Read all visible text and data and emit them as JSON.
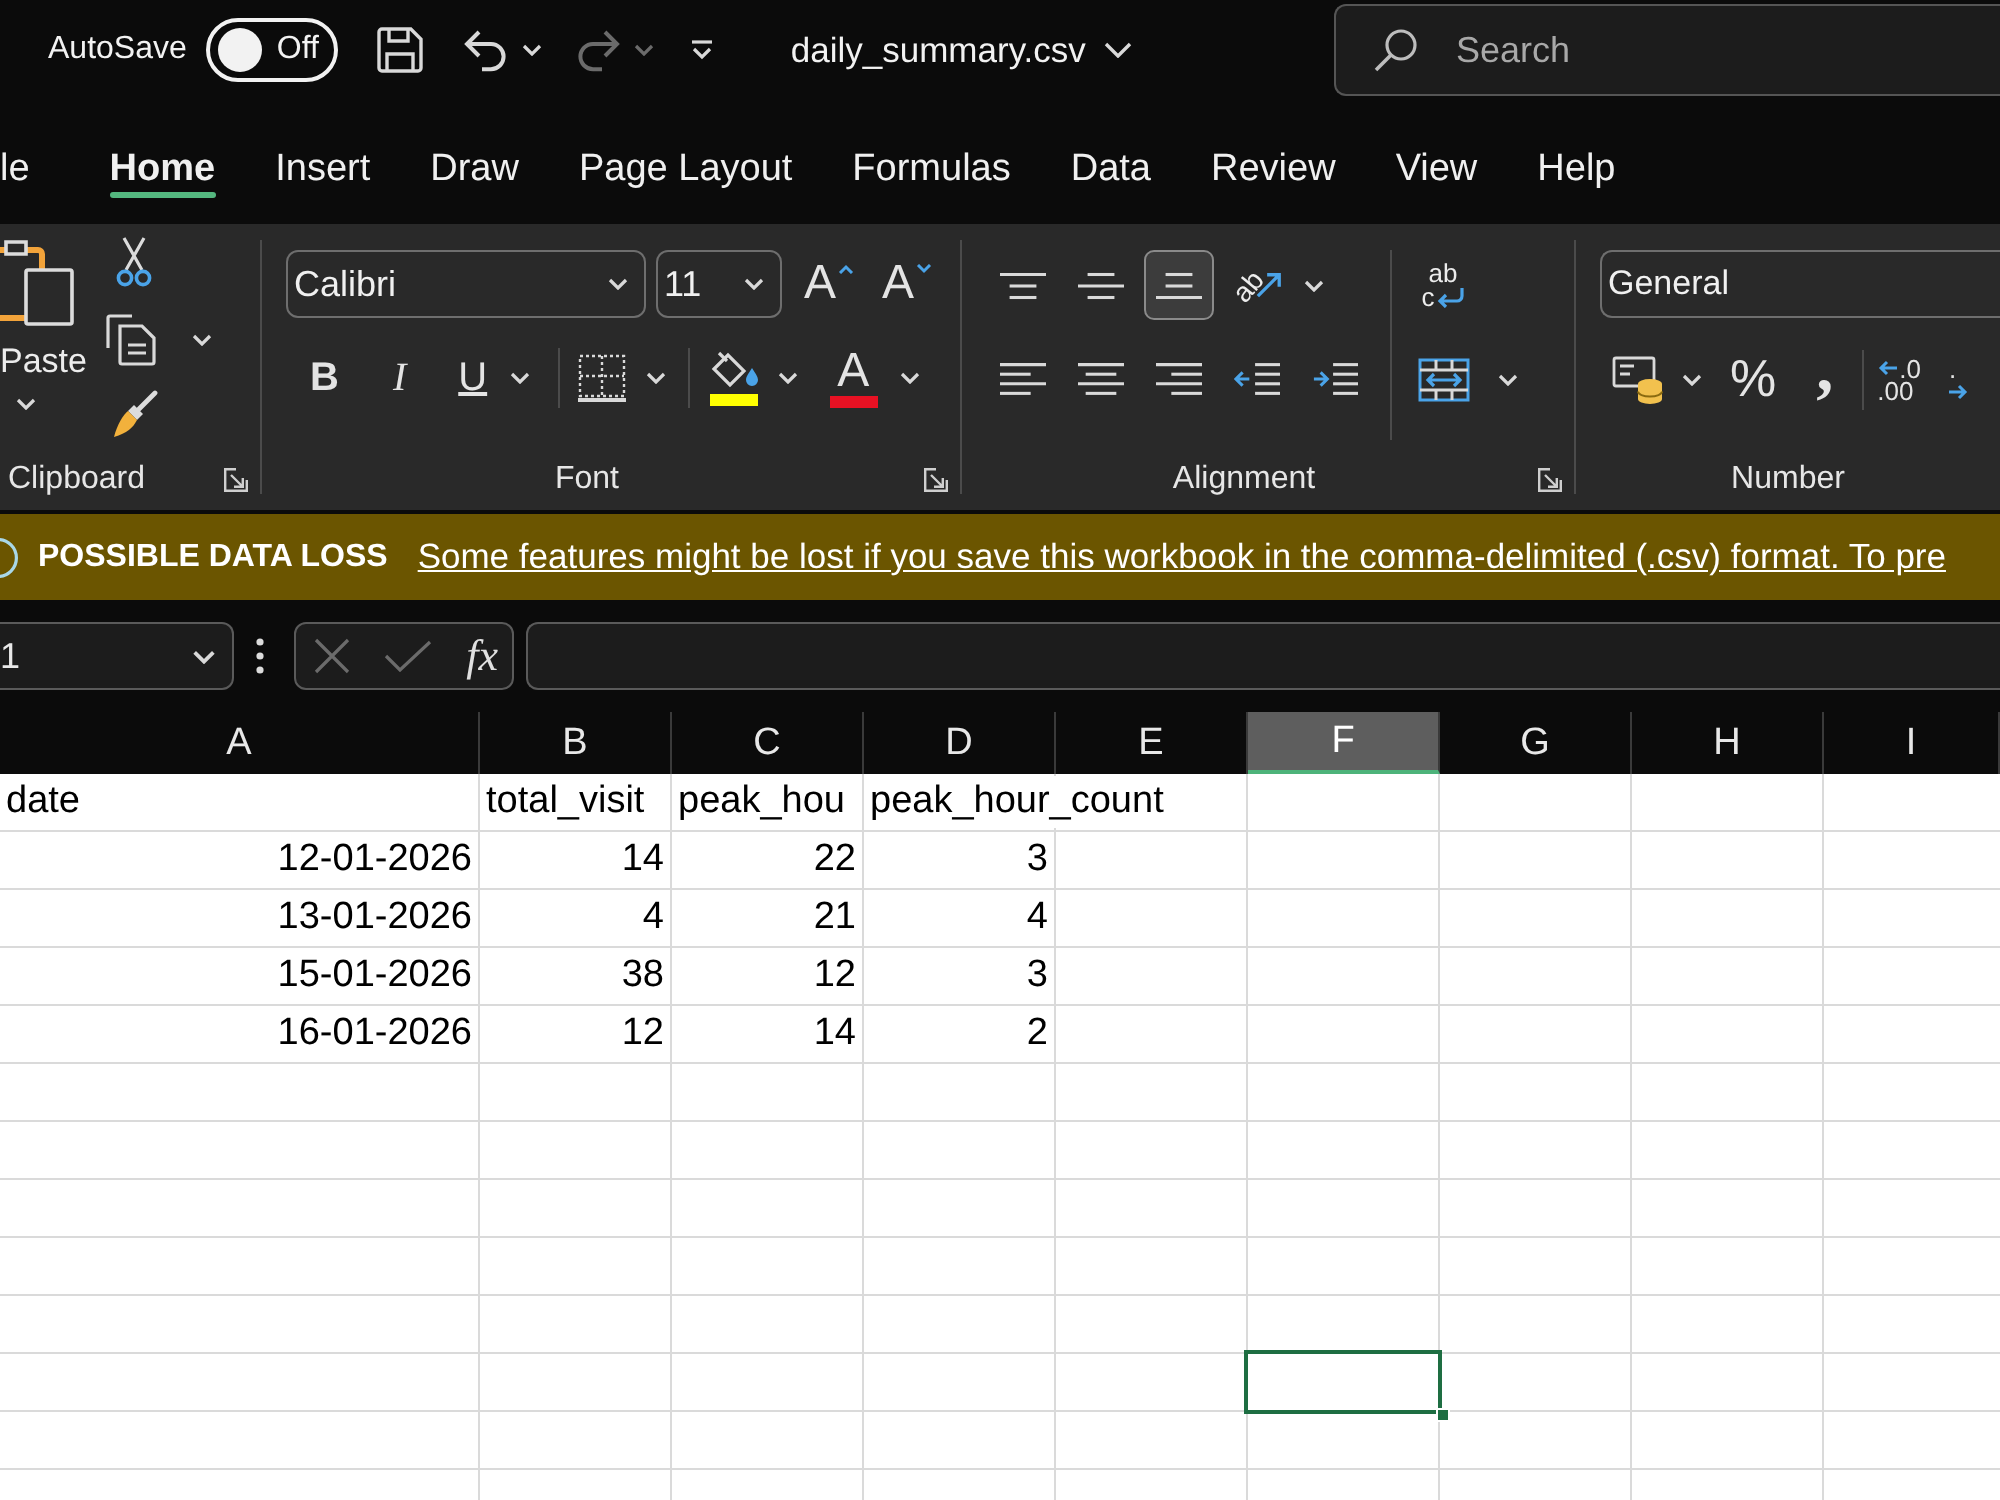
{
  "title_bar": {
    "autosave": {
      "label": "AutoSave",
      "on": false,
      "state_text": "Off"
    },
    "undo": {
      "disabled": false
    },
    "redo": {
      "disabled": true
    },
    "file_name": "daily_summary.csv",
    "search": {
      "placeholder": "Search"
    }
  },
  "ribbon_tabs": [
    {
      "label": "le",
      "selected": false
    },
    {
      "label": "Home",
      "selected": true
    },
    {
      "label": "Insert",
      "selected": false
    },
    {
      "label": "Draw",
      "selected": false
    },
    {
      "label": "Page Layout",
      "selected": false
    },
    {
      "label": "Formulas",
      "selected": false
    },
    {
      "label": "Data",
      "selected": false
    },
    {
      "label": "Review",
      "selected": false
    },
    {
      "label": "View",
      "selected": false
    },
    {
      "label": "Help",
      "selected": false
    }
  ],
  "ribbon": {
    "clipboard": {
      "paste_label": "Paste",
      "group_label": "Clipboard"
    },
    "font": {
      "font_name": "Calibri",
      "font_size": "11",
      "grow_label": "A",
      "shrink_label": "A",
      "bold_label": "B",
      "italic_label": "I",
      "underline_label": "U",
      "fill_swatch": {
        "color": "#ffff00"
      },
      "font_color_label": "A",
      "font_swatch": {
        "color": "#e81123"
      },
      "group_label": "Font"
    },
    "alignment": {
      "vertical": [
        {
          "kind": "top",
          "selected": false
        },
        {
          "kind": "middle",
          "selected": false
        },
        {
          "kind": "bottom",
          "selected": true
        }
      ],
      "orientation_label": "ab",
      "horizontal": [
        {
          "kind": "left",
          "selected": false
        },
        {
          "kind": "center",
          "selected": false
        },
        {
          "kind": "right",
          "selected": false
        }
      ],
      "wrap_text_top": "ab",
      "wrap_text_bottom": "c",
      "group_label": "Alignment"
    },
    "number": {
      "format": "General",
      "percent_label": "%",
      "comma_label": ",",
      "increase_decimal_top": ".0",
      "increase_decimal_bottom": ".00",
      "decrease_decimal_top": ".",
      "group_label": "Number"
    }
  },
  "message_bar": {
    "title": "POSSIBLE DATA LOSS",
    "link": "Some features might be lost if you save this workbook in the comma-delimited (.csv) format. To pre"
  },
  "formula_bar": {
    "name_box": "1",
    "cancel": {
      "disabled": true
    },
    "enter": {
      "disabled": true
    },
    "function_label": "fx"
  },
  "grid": {
    "columns": [
      {
        "label": "A",
        "selected": false
      },
      {
        "label": "B",
        "selected": false
      },
      {
        "label": "C",
        "selected": false
      },
      {
        "label": "D",
        "selected": false
      },
      {
        "label": "E",
        "selected": false
      },
      {
        "label": "F",
        "selected": true
      },
      {
        "label": "G",
        "selected": false
      },
      {
        "label": "H",
        "selected": false
      },
      {
        "label": "I",
        "selected": false
      }
    ],
    "rows": [
      {
        "selected": false,
        "cells": [
          {
            "text": "date",
            "kind": "text"
          },
          {
            "text": "total_visit",
            "kind": "text"
          },
          {
            "text": "peak_hou",
            "kind": "text"
          },
          {
            "text": "peak_hour_count",
            "kind": "text"
          }
        ]
      },
      {
        "selected": false,
        "cells": [
          {
            "text": "12-01-2026",
            "kind": "number"
          },
          {
            "text": "14",
            "kind": "number"
          },
          {
            "text": "22",
            "kind": "number"
          },
          {
            "text": "3",
            "kind": "number"
          }
        ]
      },
      {
        "selected": false,
        "cells": [
          {
            "text": "13-01-2026",
            "kind": "number"
          },
          {
            "text": "4",
            "kind": "number"
          },
          {
            "text": "21",
            "kind": "number"
          },
          {
            "text": "4",
            "kind": "number"
          }
        ]
      },
      {
        "selected": false,
        "cells": [
          {
            "text": "15-01-2026",
            "kind": "number"
          },
          {
            "text": "38",
            "kind": "number"
          },
          {
            "text": "12",
            "kind": "number"
          },
          {
            "text": "3",
            "kind": "number"
          }
        ]
      },
      {
        "selected": false,
        "cells": [
          {
            "text": "16-01-2026",
            "kind": "number"
          },
          {
            "text": "12",
            "kind": "number"
          },
          {
            "text": "14",
            "kind": "number"
          },
          {
            "text": "2",
            "kind": "number"
          }
        ]
      },
      {
        "selected": false
      },
      {
        "selected": false
      },
      {
        "selected": false
      },
      {
        "selected": false
      },
      {
        "selected": false
      },
      {
        "selected": true
      },
      {
        "selected": false
      }
    ]
  }
}
